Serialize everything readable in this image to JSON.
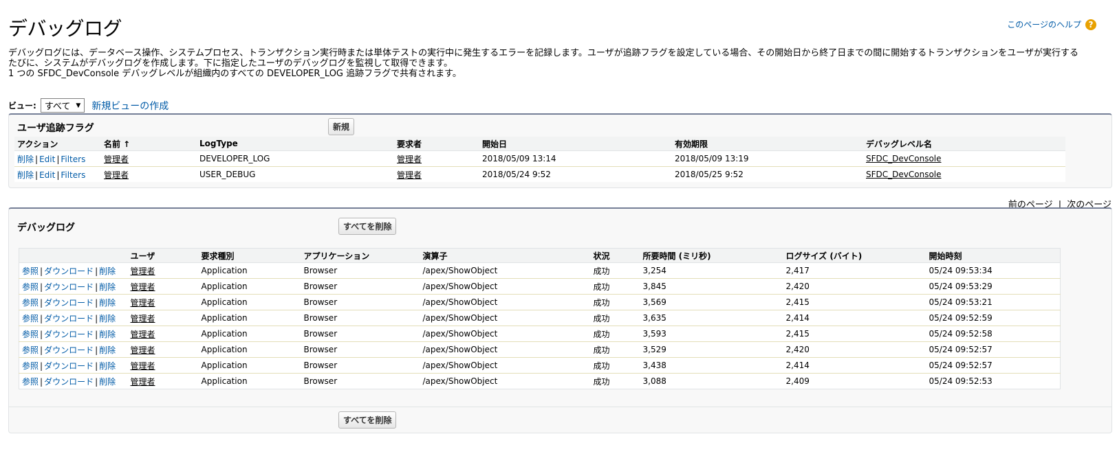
{
  "page": {
    "title": "デバッグログ",
    "help_link": "このページのヘルプ",
    "description": [
      "デバッグログには、データベース操作、システムプロセス、トランザクション実行時または単体テストの実行中に発生するエラーを記録します。ユーザが追跡フラグを設定している場合、その開始日から終了日までの間に開始するトランザクションをユーザが実行する",
      "たびに、システムがデバッグログを作成します。下に指定したユーザのデバッグログを監視して取得できます。",
      "1 つの SFDC_DevConsole デバッグレベルが組織内のすべての DEVELOPER_LOG 追跡フラグで共有されます。"
    ]
  },
  "view": {
    "label": "ビュー:",
    "selected": "すべて",
    "new_view_link": "新規ビューの作成"
  },
  "trace_flags": {
    "title": "ユーザ追跡フラグ",
    "new_button": "新規",
    "columns": [
      "アクション",
      "名前 ↑",
      "LogType",
      "要求者",
      "開始日",
      "有効期限",
      "デバッグレベル名"
    ],
    "action_labels": [
      "削除",
      "Edit",
      "Filters"
    ],
    "rows": [
      {
        "name": "管理者",
        "log_type": "DEVELOPER_LOG",
        "requested_by": "管理者",
        "start": "2018/05/09 13:14",
        "expiry": "2018/05/09 13:19",
        "level": "SFDC_DevConsole"
      },
      {
        "name": "管理者",
        "log_type": "USER_DEBUG",
        "requested_by": "管理者",
        "start": "2018/05/24 9:52",
        "expiry": "2018/05/25 9:52",
        "level": "SFDC_DevConsole"
      }
    ]
  },
  "pager": {
    "prev": "前のページ",
    "separator": "|",
    "next": "次のページ"
  },
  "debug_logs": {
    "title": "デバッグログ",
    "delete_all_button": "すべてを削除",
    "columns": [
      "",
      "ユーザ",
      "要求種別",
      "アプリケーション",
      "演算子",
      "状況",
      "所要時間 (ミリ秒)",
      "ログサイズ (バイト)",
      "開始時刻"
    ],
    "action_labels": [
      "参照",
      "ダウンロード",
      "削除"
    ],
    "rows": [
      {
        "user": "管理者",
        "request": "Application",
        "app": "Browser",
        "operation": "/apex/ShowObject",
        "status": "成功",
        "duration": "3,254",
        "size": "2,417",
        "start": "05/24 09:53:34"
      },
      {
        "user": "管理者",
        "request": "Application",
        "app": "Browser",
        "operation": "/apex/ShowObject",
        "status": "成功",
        "duration": "3,845",
        "size": "2,420",
        "start": "05/24 09:53:29"
      },
      {
        "user": "管理者",
        "request": "Application",
        "app": "Browser",
        "operation": "/apex/ShowObject",
        "status": "成功",
        "duration": "3,569",
        "size": "2,415",
        "start": "05/24 09:53:21"
      },
      {
        "user": "管理者",
        "request": "Application",
        "app": "Browser",
        "operation": "/apex/ShowObject",
        "status": "成功",
        "duration": "3,635",
        "size": "2,414",
        "start": "05/24 09:52:59"
      },
      {
        "user": "管理者",
        "request": "Application",
        "app": "Browser",
        "operation": "/apex/ShowObject",
        "status": "成功",
        "duration": "3,593",
        "size": "2,415",
        "start": "05/24 09:52:58"
      },
      {
        "user": "管理者",
        "request": "Application",
        "app": "Browser",
        "operation": "/apex/ShowObject",
        "status": "成功",
        "duration": "3,529",
        "size": "2,420",
        "start": "05/24 09:52:57"
      },
      {
        "user": "管理者",
        "request": "Application",
        "app": "Browser",
        "operation": "/apex/ShowObject",
        "status": "成功",
        "duration": "3,438",
        "size": "2,414",
        "start": "05/24 09:52:57"
      },
      {
        "user": "管理者",
        "request": "Application",
        "app": "Browser",
        "operation": "/apex/ShowObject",
        "status": "成功",
        "duration": "3,088",
        "size": "2,409",
        "start": "05/24 09:52:53"
      }
    ]
  },
  "colors": {
    "link": "#015ba7",
    "panel_border_top": "#747e96",
    "help_icon": "#e8a100"
  }
}
